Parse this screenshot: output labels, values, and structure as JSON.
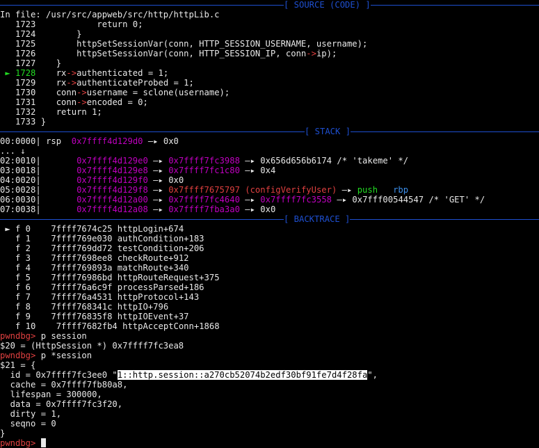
{
  "colors": {
    "rule": "#1e4fd0",
    "address": "#c000c0",
    "code_addr": "#e04040",
    "arrow": "#22dd22",
    "prompt": "#e04040"
  },
  "source": {
    "header": "[ SOURCE (CODE) ]",
    "file_label": "In file: /usr/src/appweb/src/http/httpLib.c",
    "lines": [
      {
        "num": "   1723",
        "marker": "",
        "code": "            return 0;"
      },
      {
        "num": "   1724",
        "marker": "",
        "code": "        }"
      },
      {
        "num": "   1725",
        "marker": "",
        "code": "        httpSetSessionVar(conn, HTTP_SESSION_USERNAME, username);"
      },
      {
        "num": "   1726",
        "marker": "",
        "code": "        httpSetSessionVar(conn, HTTP_SESSION_IP, conn->ip);"
      },
      {
        "num": "   1727",
        "marker": "",
        "code": "    }"
      },
      {
        "num": "1728",
        "marker": " ► ",
        "code": "    rx->authenticated = 1;"
      },
      {
        "num": "   1729",
        "marker": "",
        "code": "    rx->authenticateProbed = 1;"
      },
      {
        "num": "   1730",
        "marker": "",
        "code": "    conn->username = sclone(username);"
      },
      {
        "num": "   1731",
        "marker": "",
        "code": "    conn->encoded = 0;"
      },
      {
        "num": "   1732",
        "marker": "",
        "code": "    return 1;"
      },
      {
        "num": "   1733",
        "marker": "",
        "code": " }"
      }
    ]
  },
  "stack": {
    "header": "[ STACK ]",
    "row0": {
      "off": "00:0000",
      "reg": "rsp",
      "addr": "0x7ffff4d129d0",
      "arrow": "—▸",
      "val": "0x0"
    },
    "ellipsis": "... ↓",
    "rows": [
      {
        "off": "02:0010",
        "addr": "0x7ffff4d129e0",
        "a1": "—▸",
        "p1": "0x7ffff7fc3988",
        "a2": "—▸",
        "tail": "0x656d656b6174 /* 'takeme' */"
      },
      {
        "off": "03:0018",
        "addr": "0x7ffff4d129e8",
        "a1": "—▸",
        "p1": "0x7ffff7fc1c80",
        "a2": "—▸",
        "tail": "0x4"
      },
      {
        "off": "04:0020",
        "addr": "0x7ffff4d129f0",
        "a1": "—▸",
        "p1": "",
        "a2": "",
        "tail": "0x0"
      },
      {
        "off": "05:0028",
        "addr": "0x7ffff4d129f8",
        "a1": "—▸",
        "p1": "0x7ffff7675797 (configVerifyUser)",
        "a2": "—▸",
        "tail_ins": "push",
        "tail_reg": "rbp"
      },
      {
        "off": "06:0030",
        "addr": "0x7ffff4d12a00",
        "a1": "—▸",
        "p1": "0x7ffff7fc4640",
        "a2": "—▸",
        "p2": "0x7ffff7fc3558",
        "a3": "—▸",
        "tail": "0x7fff00544547 /* 'GET' */"
      },
      {
        "off": "07:0038",
        "addr": "0x7ffff4d12a08",
        "a1": "—▸",
        "p1": "0x7ffff7fba3a0",
        "a2": "—▸",
        "tail": "0x0"
      }
    ]
  },
  "backtrace": {
    "header": "[ BACKTRACE ]",
    "frames": [
      {
        "mark": " ► f 0",
        "addr": "    7ffff7674c25",
        "sym": "httpLogin+674"
      },
      {
        "mark": "   f 1",
        "addr": "    7ffff769e030",
        "sym": "authCondition+183"
      },
      {
        "mark": "   f 2",
        "addr": "    7ffff769dd72",
        "sym": "testCondition+206"
      },
      {
        "mark": "   f 3",
        "addr": "    7ffff7698ee8",
        "sym": "checkRoute+912"
      },
      {
        "mark": "   f 4",
        "addr": "    7ffff769893a",
        "sym": "matchRoute+340"
      },
      {
        "mark": "   f 5",
        "addr": "    7ffff76986bd",
        "sym": "httpRouteRequest+375"
      },
      {
        "mark": "   f 6",
        "addr": "    7ffff76a6c9f",
        "sym": "processParsed+186"
      },
      {
        "mark": "   f 7",
        "addr": "    7ffff76a4531",
        "sym": "httpProtocol+143"
      },
      {
        "mark": "   f 8",
        "addr": "    7ffff768341c",
        "sym": "httpIO+796"
      },
      {
        "mark": "   f 9",
        "addr": "    7ffff76835f8",
        "sym": "httpIOEvent+37"
      },
      {
        "mark": "   f 10",
        "addr": "    7ffff7682fb4",
        "sym": "httpAcceptConn+1868"
      }
    ]
  },
  "console": {
    "prompt": "pwndbg>",
    "cmd1": " p session",
    "out1": "$20 = (HttpSession *) 0x7ffff7fc3ea8",
    "cmd2": " p *session",
    "out2_0": "$21 = {",
    "id_prefix": "  id = 0x7ffff7fc3ee0 \"",
    "id_value": "1::http.session::a270cb52074b2edf30bf91fe7d4f28fa",
    "id_suffix": "\",",
    "fields": [
      "  cache = 0x7ffff7fb80a8,",
      "  lifespan = 300000,",
      "  data = 0x7ffff7fc3f20,",
      "  dirty = 1,",
      "  seqno = 0"
    ],
    "close": "}",
    "final_prompt": "pwndbg>"
  }
}
